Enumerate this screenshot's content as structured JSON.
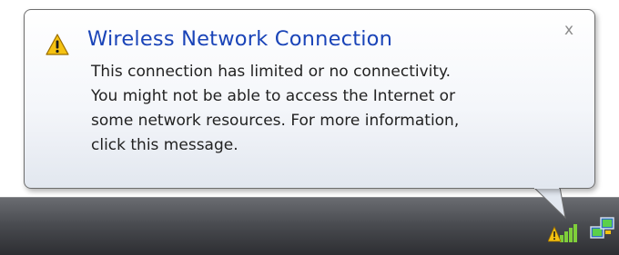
{
  "notification": {
    "title": "Wireless Network Connection",
    "close_label": "x",
    "message_lines": [
      "This connection has limited or no connectivity.",
      "You might not be able to access the Internet or",
      "some network resources. For more information,",
      "click this message."
    ],
    "title_color": "#1a44b8"
  },
  "icons": {
    "notification": "warning-triangle-icon",
    "tray": [
      "wireless-signal-warning-icon",
      "network-connection-icon"
    ]
  }
}
